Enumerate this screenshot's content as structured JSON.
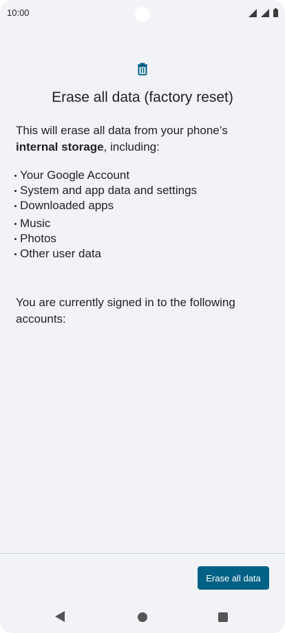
{
  "status_bar": {
    "time": "10:00",
    "icons": [
      "signal-icon",
      "signal-icon",
      "battery-icon"
    ]
  },
  "dialog": {
    "icon": "trash-icon",
    "accent_color": "#006184",
    "title": "Erase all data (factory reset)",
    "intro_before": "This will erase all data from your phone’s ",
    "intro_bold": "internal storage",
    "intro_after": ", including:",
    "items": [
      "Your Google Account",
      "System and app data and settings",
      "Downloaded apps",
      "Music",
      "Photos",
      "Other user data"
    ],
    "accounts_text": "You are currently signed in to the following accounts:"
  },
  "footer": {
    "erase_label": "Erase all data"
  },
  "nav_bar": {
    "icons": [
      "back-icon",
      "home-icon",
      "recents-icon"
    ]
  }
}
